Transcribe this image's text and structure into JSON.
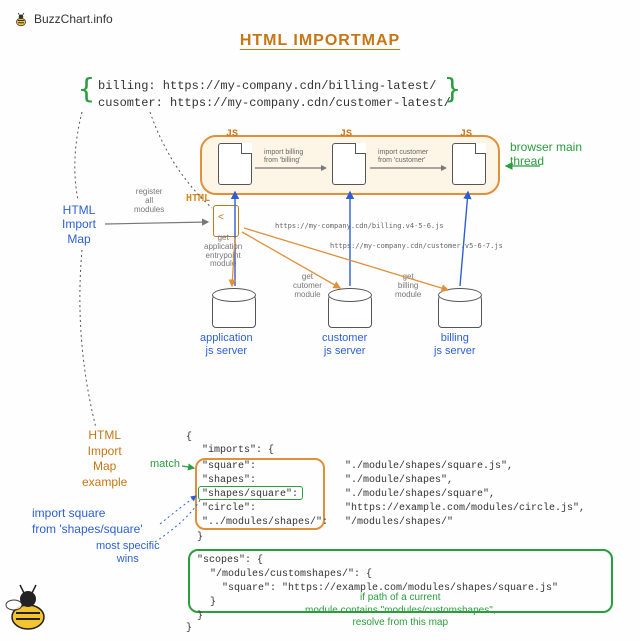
{
  "meta": {
    "site": "BuzzChart.info"
  },
  "title": "HTML IMPORTMAP",
  "importmap_sample": {
    "line1": "billing: https://my-company.cdn/billing-latest/",
    "line2": "cusomter: https://my-company.cdn/customer-latest/"
  },
  "browser": {
    "js_label": "JS",
    "import1": "import billing\nfrom 'billing'",
    "import2": "import customer\nfrom 'customer'",
    "main_thread": "browser main\nthread",
    "html_label": "HTML"
  },
  "labels": {
    "html_import_map": "HTML\nImport\nMap",
    "register": "register\nall\nmodules",
    "get_entrypoint": "get\napplication\nentrypoint\nmodule",
    "get_customer": "get\ncutomer\nmodule",
    "get_billing": "get\nbilling\nmodule"
  },
  "urls": {
    "billing": "https://my-company.cdn/billing.v4-5-6.js",
    "customer": "https://my-company.cdn/customer.v5-6-7.js"
  },
  "servers": {
    "app": "application\njs server",
    "customer": "customer\njs server",
    "billing": "billing\njs server"
  },
  "example": {
    "heading": "HTML\nImport\nMap\nexample",
    "match": "match",
    "open": "{",
    "imports_key": "\"imports\": {",
    "keys": [
      "\"square\":",
      "\"shapes\":",
      "\"shapes/square\":",
      "\"circle\":",
      "\"../modules/shapes/\":"
    ],
    "vals": [
      "\"./module/shapes/square.js\",",
      "\"./module/shapes\",",
      "\"./module/shapes/square\",",
      "\"https://example.com/modules/circle.js\",",
      "\"/modules/shapes/\""
    ],
    "close_imports": "}",
    "import_stmt": "import square\nfrom 'shapes/square'",
    "specific": "most specific\nwins",
    "scopes_open": "\"scopes\": {",
    "scope_path": "\"/modules/customshapes/\": {",
    "scope_entry": "\"square\": \"https://example.com/modules/shapes/square.js\"",
    "scopes_note": "if path of a current\nmodule contains \"modules/customshapes\",\nresolve from this map",
    "close_brace": "}"
  }
}
